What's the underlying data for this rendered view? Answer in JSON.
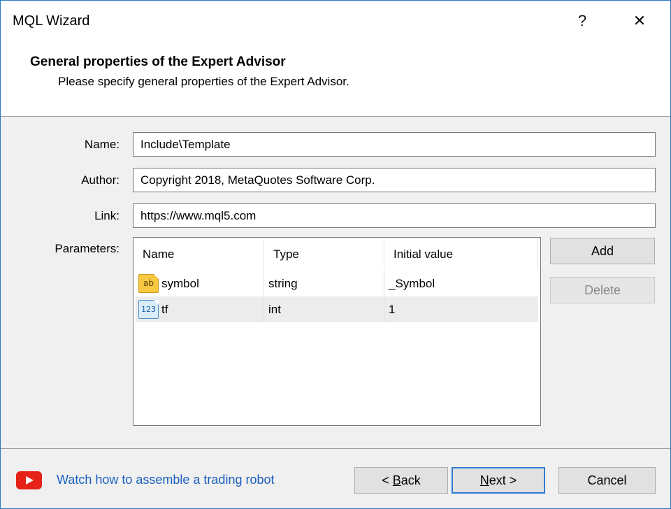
{
  "window": {
    "title": "MQL Wizard",
    "help_glyph": "?",
    "close_glyph": "✕"
  },
  "header": {
    "title": "General properties of the Expert Advisor",
    "subtitle": "Please specify general properties of the Expert Advisor."
  },
  "form": {
    "name_label": "Name:",
    "name_value": "Include\\Template",
    "author_label": "Author:",
    "author_value": "Copyright 2018, MetaQuotes Software Corp.",
    "link_label": "Link:",
    "link_value": "https://www.mql5.com",
    "parameters_label": "Parameters:"
  },
  "parameters": {
    "columns": [
      "Name",
      "Type",
      "Initial value"
    ],
    "rows": [
      {
        "icon": "string-type-icon",
        "icon_text": "ab",
        "name": "symbol",
        "type": "string",
        "value": "_Symbol"
      },
      {
        "icon": "integer-type-icon",
        "icon_text": "123",
        "name": "tf",
        "type": "int",
        "value": "1"
      }
    ],
    "add_label": "Add",
    "delete_label": "Delete"
  },
  "footer": {
    "watch_link": "Watch how to assemble a trading robot",
    "back_label_pre": "< ",
    "back_label_key": "B",
    "back_label_post": "ack",
    "next_label_key": "N",
    "next_label_post": "ext >",
    "cancel_label": "Cancel"
  },
  "colors": {
    "accent": "#2f7bd2",
    "link": "#1a5fbf",
    "youtube": "#e62117"
  }
}
